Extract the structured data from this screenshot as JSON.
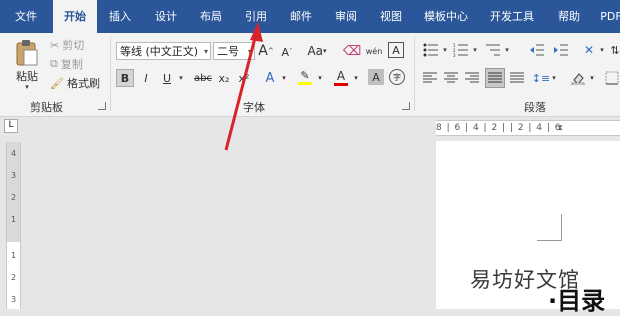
{
  "tabs": [
    {
      "label": "文件"
    },
    {
      "label": "开始"
    },
    {
      "label": "插入"
    },
    {
      "label": "设计"
    },
    {
      "label": "布局"
    },
    {
      "label": "引用"
    },
    {
      "label": "邮件"
    },
    {
      "label": "审阅"
    },
    {
      "label": "视图"
    },
    {
      "label": "模板中心"
    },
    {
      "label": "开发工具"
    },
    {
      "label": "帮助"
    },
    {
      "label": "PDF"
    }
  ],
  "clipboard": {
    "paste_label": "粘贴",
    "cut_label": "剪切",
    "copy_label": "复制",
    "format_painter_label": "格式刷",
    "group_label": "剪贴板"
  },
  "font": {
    "font_name": "等线 (中文正文)",
    "font_size": "二号",
    "group_label": "字体",
    "grow": "A",
    "shrink": "A",
    "change_case": "Aa",
    "bold": "B",
    "italic": "I",
    "underline": "U",
    "strike": "abc",
    "subscript": "x₂",
    "superscript": "x²",
    "text_effect": "A",
    "font_color": "A",
    "char_shading": "A",
    "char_border": "A",
    "enclose": "字",
    "phonetic": "wén",
    "highlight_color": "#ffff00",
    "font_color_value": "#e00000"
  },
  "paragraph": {
    "group_label": "段落"
  },
  "ruler": {
    "top_marks": "8 | 6 | 4 | 2 |     | 2 | 4 | 6",
    "tab_selector": "L",
    "left_marks": [
      "4",
      "3",
      "2",
      "1",
      "1",
      "2",
      "3"
    ]
  },
  "accent_color": "#2b579a",
  "document": {
    "heading": "·目录",
    "watermark": "易坊好文馆"
  }
}
